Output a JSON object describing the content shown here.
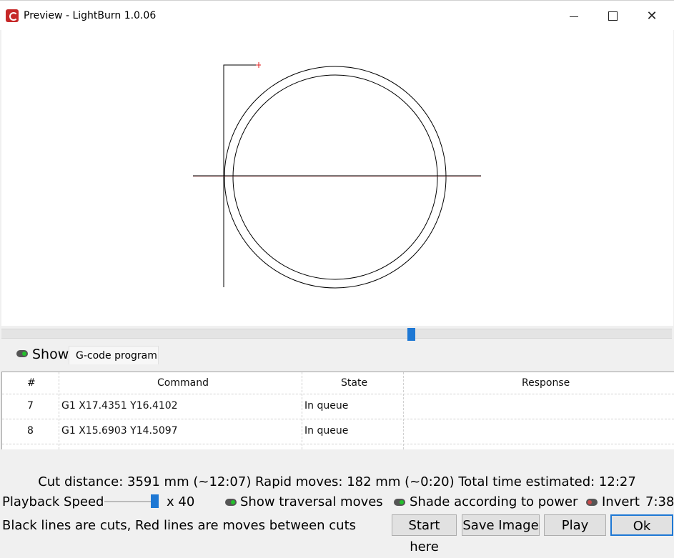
{
  "window": {
    "title": "Preview - LightBurn 1.0.06",
    "minimize_icon": "minimize-icon",
    "maximize_icon": "maximize-icon",
    "close_icon": "close-icon"
  },
  "preview": {
    "cut_color": "#000000",
    "move_color": "#e02020"
  },
  "playback_position": 0.58,
  "show_bar": {
    "label": "Show",
    "toggle_on": true,
    "tab_label": "G-code program"
  },
  "gcode_table": {
    "columns": [
      "#",
      "Command",
      "State",
      "Response"
    ],
    "rows": [
      {
        "num": "7",
        "command": "G1  X17.4351 Y16.4102",
        "state": "In queue",
        "response": ""
      },
      {
        "num": "8",
        "command": "G1  X15.6903 Y14.5097",
        "state": "In queue",
        "response": ""
      }
    ]
  },
  "stats": {
    "text": "Cut distance: 3591 mm (~12:07)   Rapid moves: 182 mm (~0:20)   Total time estimated: 12:27"
  },
  "controls": {
    "playback_label": "Playback Speed",
    "speed_multiplier": "x 40",
    "speed_value": 40,
    "show_traversal_label": "Show traversal moves",
    "show_traversal_on": true,
    "shade_label": "Shade according to power",
    "shade_on": true,
    "invert_label": "Invert",
    "invert_on": false,
    "time_elapsed": "7:38"
  },
  "footer": {
    "legend": "Black lines are cuts, Red lines are moves between cuts",
    "start_here": "Start here",
    "save_image": "Save Image",
    "play": "Play",
    "ok": "Ok"
  },
  "colors": {
    "accent": "#1e78d4",
    "toggle_on": "#22c02a",
    "toggle_off": "#c84a4a"
  }
}
